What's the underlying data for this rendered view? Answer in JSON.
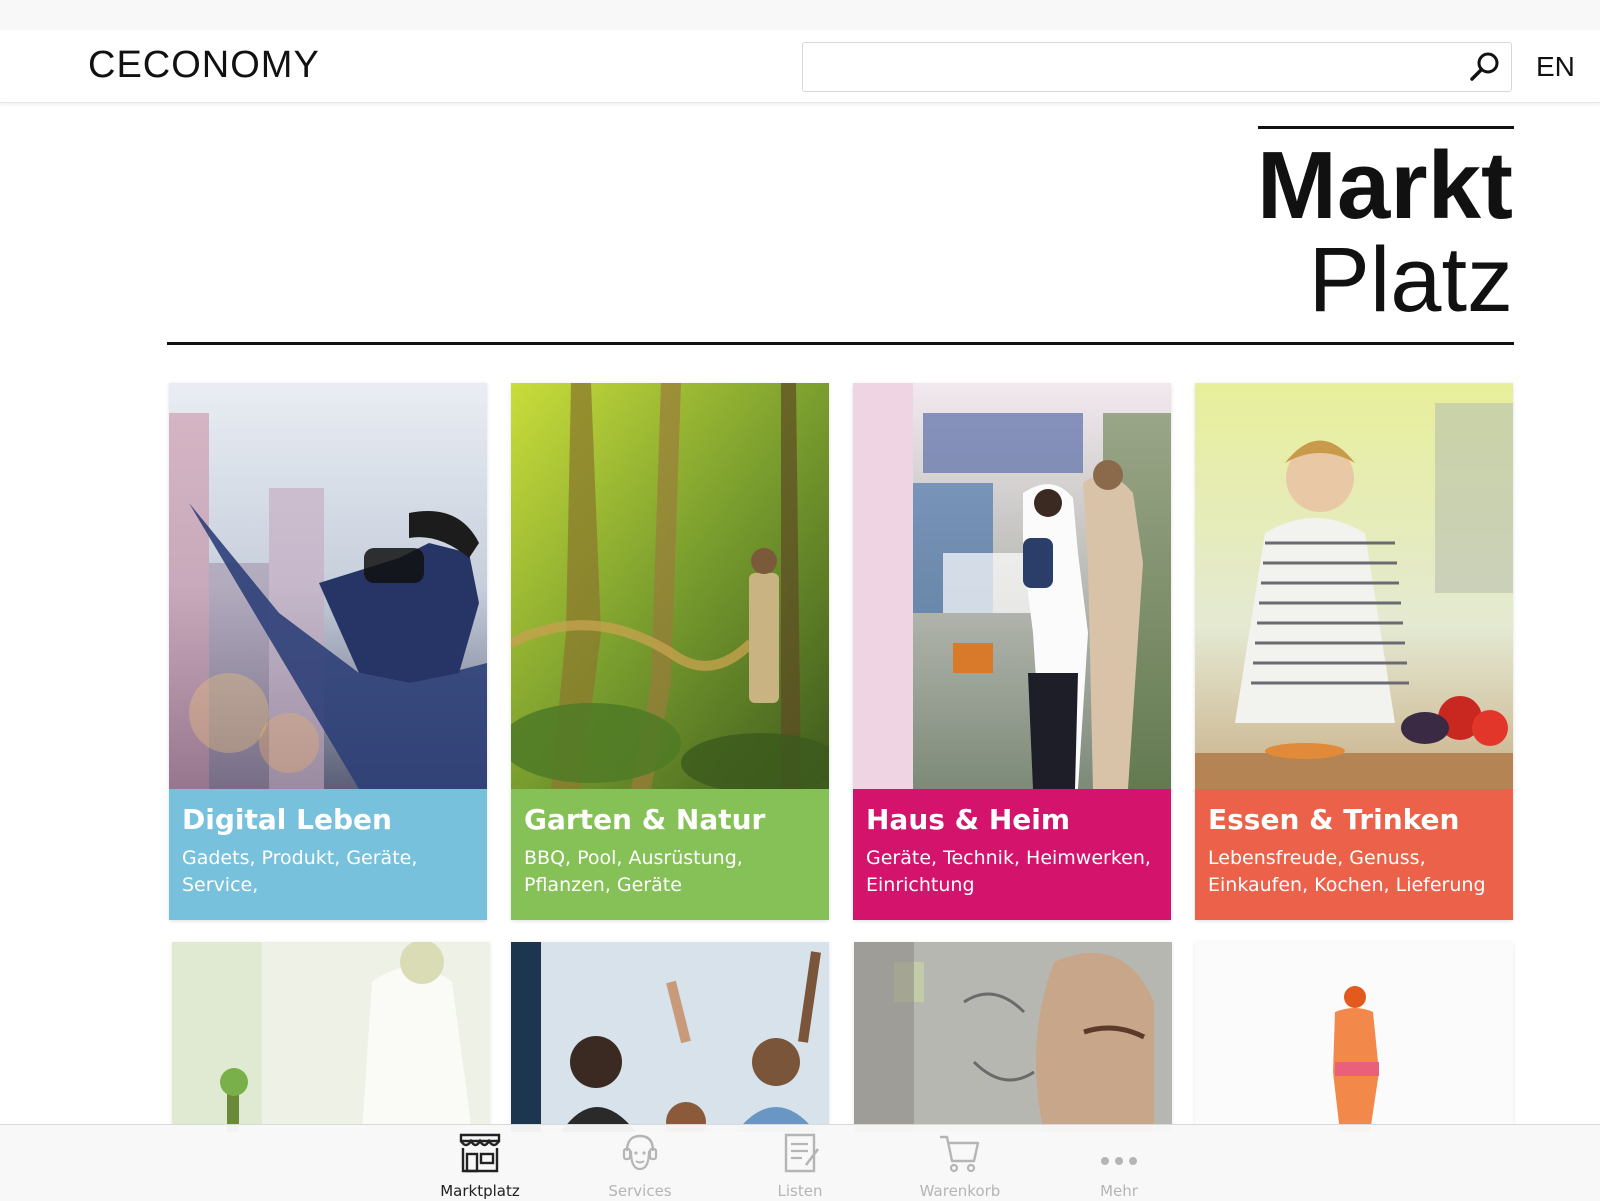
{
  "header": {
    "logo": "CECONOMY",
    "search_value": "",
    "lang": "EN"
  },
  "page": {
    "title_bold": "Markt",
    "title_light": "Platz"
  },
  "categories": [
    {
      "title": "Digital Leben",
      "subtitle": "Gadets, Produkt, Geräte, Service,",
      "color": "#78c1dc"
    },
    {
      "title": "Garten & Natur",
      "subtitle": "BBQ, Pool, Ausrüstung, Pflanzen, Geräte",
      "color": "#86c157"
    },
    {
      "title": "Haus & Heim",
      "subtitle": "Geräte, Technik, Heimwerken, Einrichtung",
      "color": "#d4136d"
    },
    {
      "title": "Essen & Trinken",
      "subtitle": "Lebensfreude, Genuss, Einkaufen, Kochen, Lieferung",
      "color": "#eb6149"
    }
  ],
  "tabbar": {
    "items": [
      {
        "label": "Marktplatz",
        "icon": "store-icon",
        "active": true
      },
      {
        "label": "Services",
        "icon": "support-agent-icon",
        "active": false
      },
      {
        "label": "Listen",
        "icon": "list-icon",
        "active": false
      },
      {
        "label": "Warenkorb",
        "icon": "cart-icon",
        "active": false
      },
      {
        "label": "Mehr",
        "icon": "more-dots-icon",
        "active": false
      }
    ]
  }
}
